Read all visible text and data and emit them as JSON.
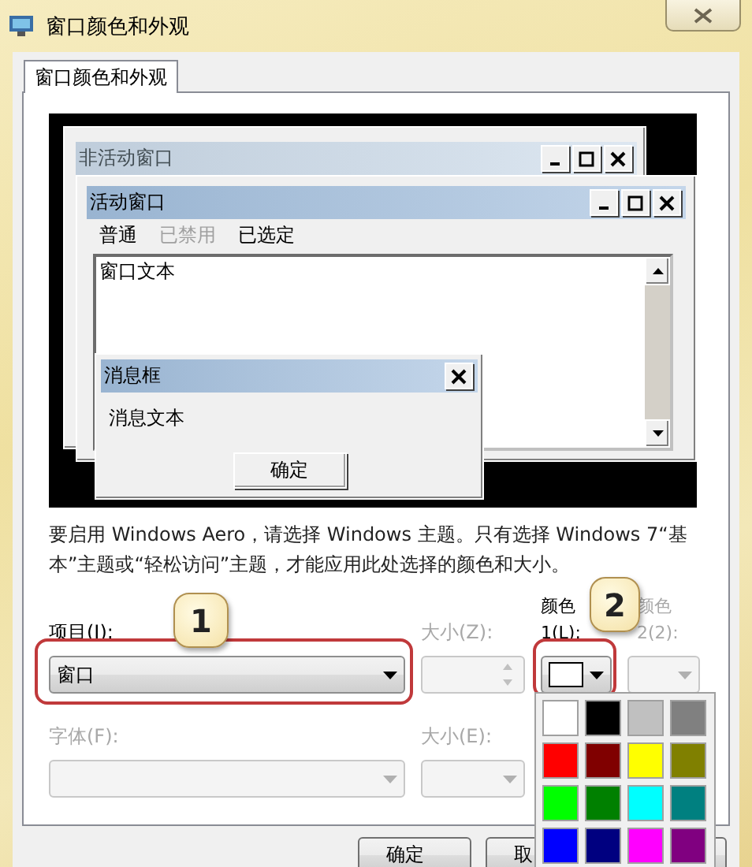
{
  "window": {
    "title": "窗口颜色和外观"
  },
  "tabs": [
    {
      "label": "窗口颜色和外观",
      "selected": true
    }
  ],
  "preview": {
    "inactive_window": {
      "title": "非活动窗口"
    },
    "active_window": {
      "title": "活动窗口",
      "menu": [
        {
          "label": "普通",
          "disabled": false
        },
        {
          "label": "已禁用",
          "disabled": true
        },
        {
          "label": "已选定",
          "disabled": false
        }
      ],
      "text": "窗口文本"
    },
    "message_box": {
      "title": "消息框",
      "text": "消息文本",
      "button": "确定"
    }
  },
  "description": "要启用 Windows Aero，请选择 Windows 主题。只有选择 Windows 7“基本”主题或“轻松访问”主题，才能应用此处选择的颜色和大小。",
  "item": {
    "label": "项目(I):",
    "value": "窗口",
    "disabled": false
  },
  "size": {
    "label": "大小(Z):",
    "disabled": true
  },
  "color_1": {
    "label": "颜色 1(L):",
    "color": "#ffffff",
    "disabled": false
  },
  "color_2": {
    "label": "颜色 2(2):",
    "disabled": true
  },
  "font": {
    "label": "字体(F):",
    "disabled": true
  },
  "font_size": {
    "label": "大小(E):",
    "disabled": true
  },
  "palette": [
    {
      "color": "#ffffff"
    },
    {
      "color": "#000000"
    },
    {
      "color": "#c0c0c0"
    },
    {
      "color": "#808080"
    },
    {
      "color": "#ff0000"
    },
    {
      "color": "#800000"
    },
    {
      "color": "#ffff00"
    },
    {
      "color": "#808000"
    },
    {
      "color": "#00ff00"
    },
    {
      "color": "#008000"
    },
    {
      "color": "#00ffff"
    },
    {
      "color": "#008080"
    },
    {
      "color": "#0000ff"
    },
    {
      "color": "#000080"
    },
    {
      "color": "#ff00ff"
    },
    {
      "color": "#800080"
    }
  ],
  "callouts": [
    "1",
    "2"
  ],
  "buttons": [
    {
      "label": "确定"
    },
    {
      "label": "取"
    }
  ]
}
